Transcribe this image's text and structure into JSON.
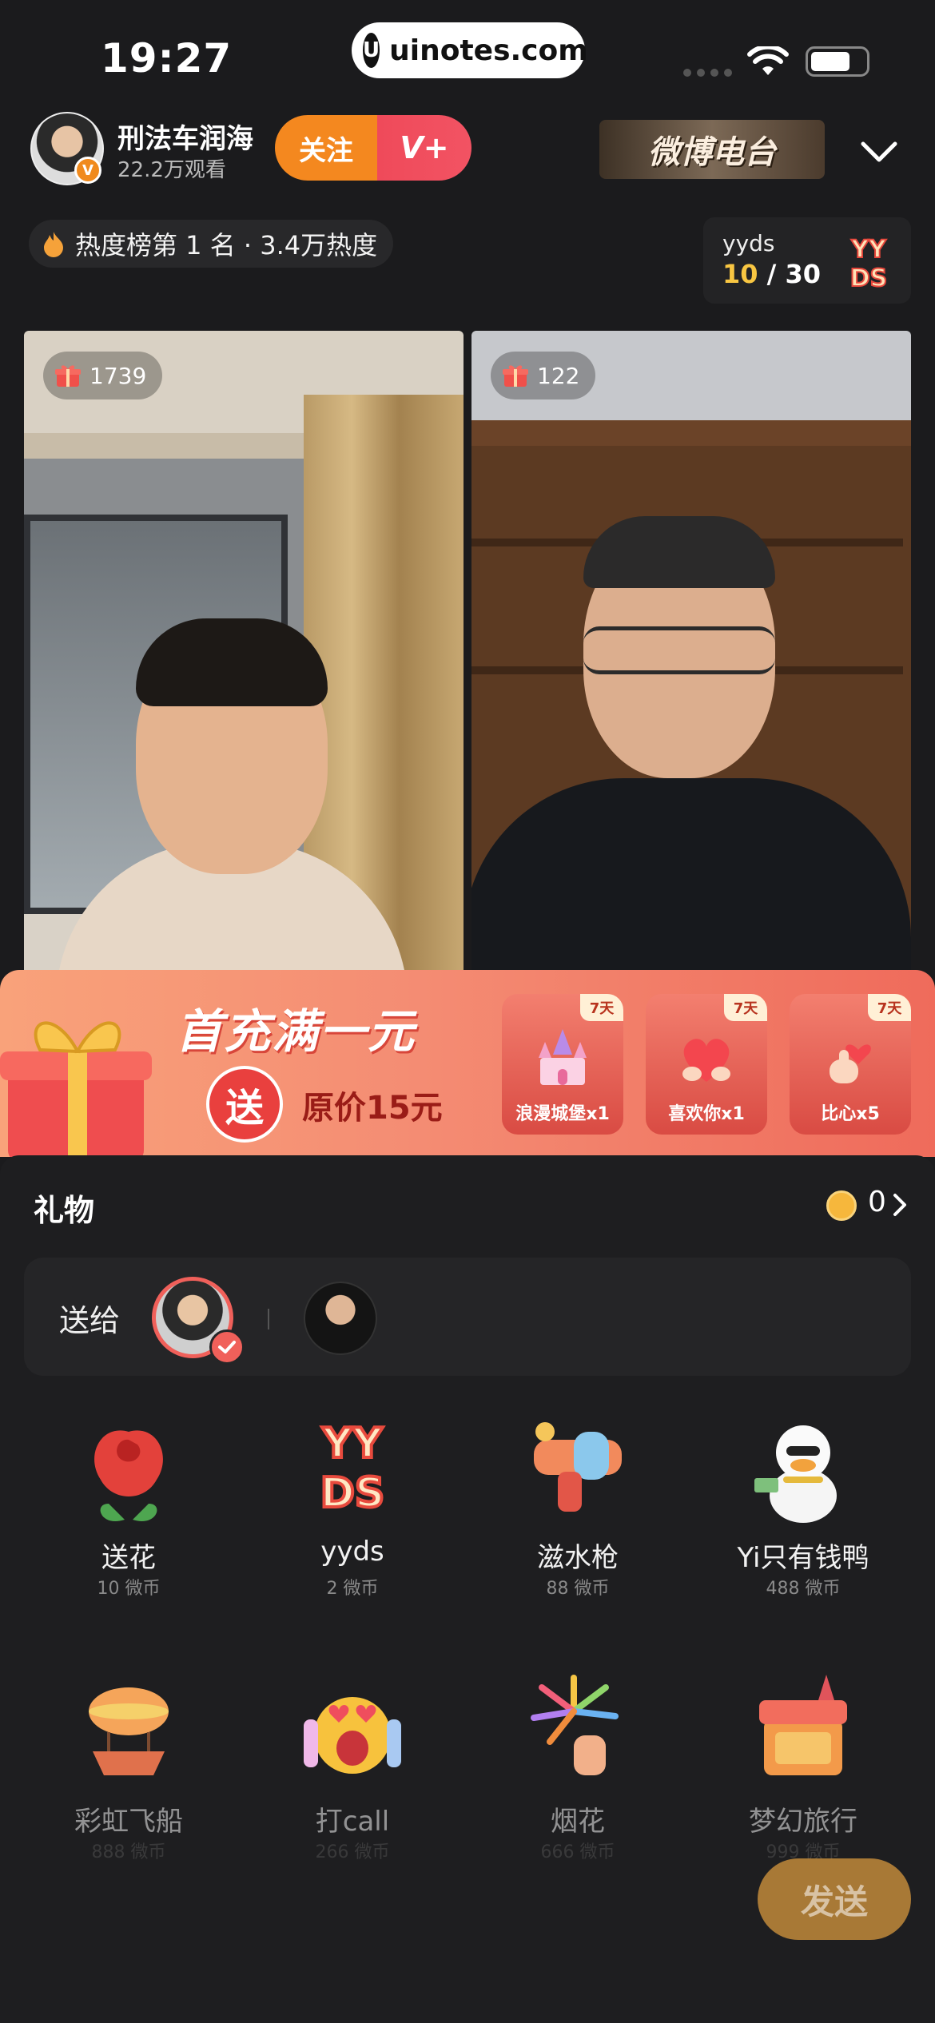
{
  "status_bar": {
    "time": "19:27",
    "watermark": "uinotes.com"
  },
  "header": {
    "host_name": "刑法车润海",
    "viewers": "22.2万观看",
    "follow_label": "关注",
    "vplus_label": "V+",
    "radio_banner": "微博电台"
  },
  "heat": {
    "text": "热度榜第 1 名 · 3.4万热度"
  },
  "yyds": {
    "title": "yyds",
    "current": "10",
    "sep": "/",
    "total": "30",
    "logo_text": "YYDS"
  },
  "videos": [
    {
      "gift_count": "1739"
    },
    {
      "gift_count": "122"
    }
  ],
  "promo": {
    "title": "首充满一元",
    "send": "送",
    "original_price": "原价15元",
    "rewards": [
      {
        "days": "7天",
        "label": "浪漫城堡x1"
      },
      {
        "days": "7天",
        "label": "喜欢你x1"
      },
      {
        "days": "7天",
        "label": "比心x5"
      }
    ]
  },
  "panel": {
    "title": "礼物",
    "coin_count": "0",
    "send_to": "送给"
  },
  "gifts": [
    {
      "name": "送花",
      "price": "10 微币"
    },
    {
      "name": "yyds",
      "price": "2 微币"
    },
    {
      "name": "滋水枪",
      "price": "88 微币"
    },
    {
      "name": "Yi只有钱鸭",
      "price": "488 微币"
    },
    {
      "name": "彩虹飞船",
      "price": "888 微币"
    },
    {
      "name": "打call",
      "price": "266 微币"
    },
    {
      "name": "烟花",
      "price": "666 微币"
    },
    {
      "name": "梦幻旅行",
      "price": "999 微币"
    }
  ],
  "send_button": "发送",
  "colors": {
    "accent_orange": "#f4881f",
    "accent_red": "#ef4a5a",
    "heat_gold": "#f8c642"
  }
}
